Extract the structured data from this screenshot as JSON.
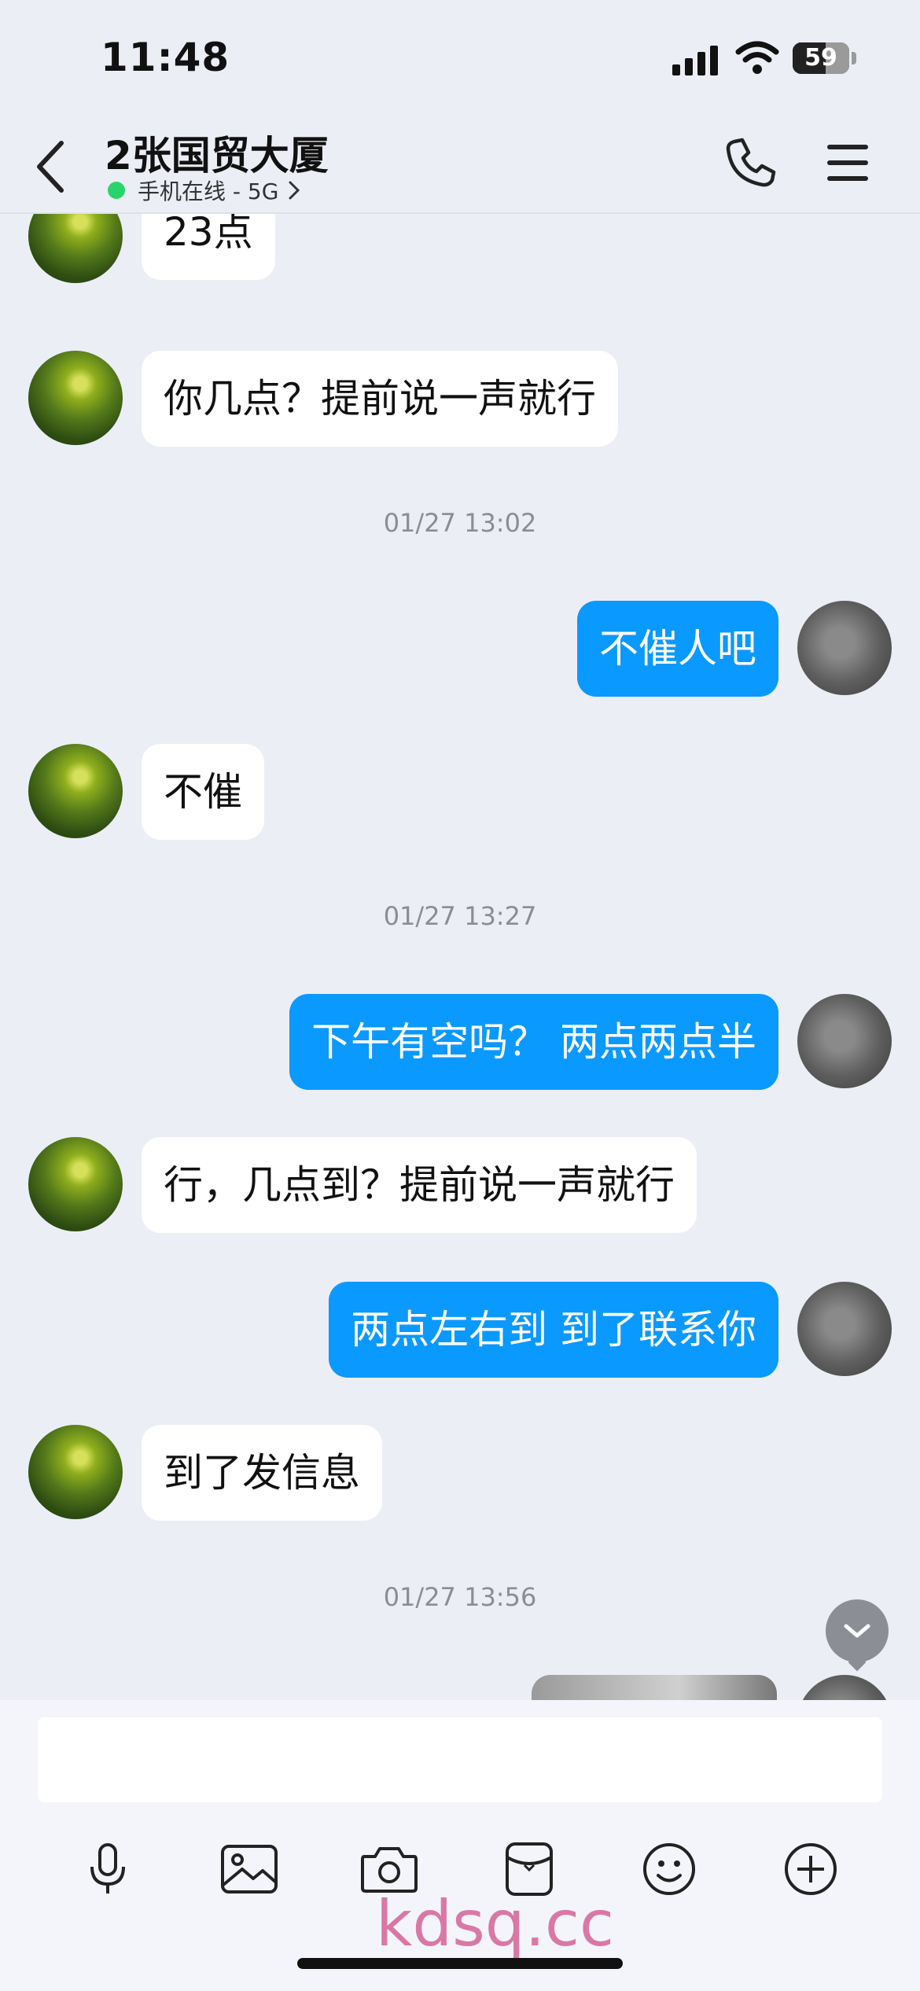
{
  "status_bar": {
    "time": "11:48",
    "battery": "59",
    "battery_level": 0.59
  },
  "header": {
    "title": "2张国贸大厦",
    "subtitle": "手机在线 - 5G",
    "online_color": "#2bd46a"
  },
  "messages": [
    {
      "type": "in",
      "text": "23点"
    },
    {
      "type": "in",
      "text": "你几点？提前说一声就行"
    },
    {
      "type": "time",
      "text": "01/27 13:02"
    },
    {
      "type": "out",
      "text": "不催人吧"
    },
    {
      "type": "in",
      "text": "不催"
    },
    {
      "type": "time",
      "text": "01/27 13:27"
    },
    {
      "type": "out",
      "text": "下午有空吗？ 两点两点半"
    },
    {
      "type": "in",
      "text": "行，几点到？提前说一声就行"
    },
    {
      "type": "out",
      "text": "两点左右到 到了联系你"
    },
    {
      "type": "in",
      "text": "到了发信息"
    },
    {
      "type": "time",
      "text": "01/27 13:56"
    }
  ],
  "composer": {
    "tools": [
      "microphone-icon",
      "image-icon",
      "camera-icon",
      "red-packet-icon",
      "emoji-icon",
      "plus-icon"
    ]
  },
  "watermark": "kdsq.cc",
  "colors": {
    "accent": "#0a99ff",
    "background": "#eceef6"
  }
}
